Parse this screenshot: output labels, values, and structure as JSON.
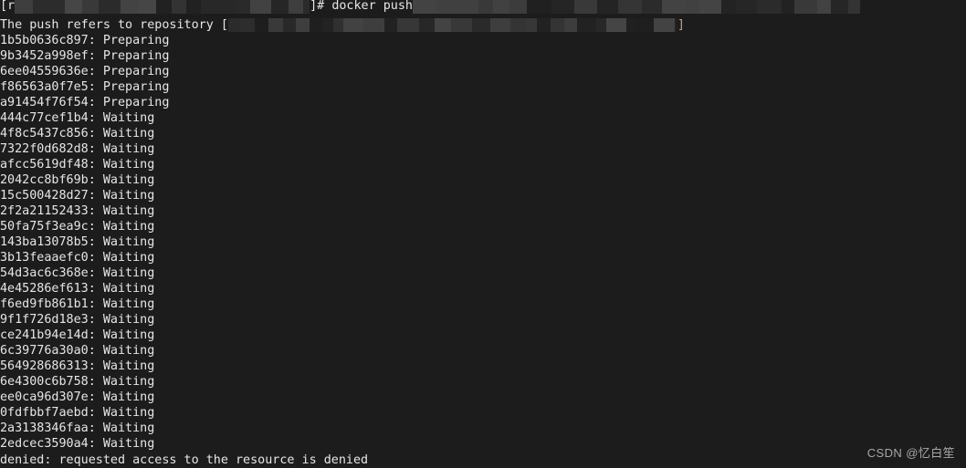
{
  "terminal": {
    "background_color": "#1c1c1c",
    "text_color": "#e6e6e6",
    "highlight_color": "#d7a442",
    "prompt_line": {
      "prefix": "[r",
      "redacted_host_path": "",
      "suffix": "]# ",
      "command": "docker push",
      "redacted_image_ref": ""
    },
    "push_line": {
      "text": "The push refers to repository ",
      "bracket_open": "[",
      "redacted_repo": "",
      "bracket_close": "]"
    },
    "layers": [
      {
        "id": "1b5b0636c897",
        "status": "Preparing"
      },
      {
        "id": "9b3452a998ef",
        "status": "Preparing"
      },
      {
        "id": "6ee04559636e",
        "status": "Preparing"
      },
      {
        "id": "f86563a0f7e5",
        "status": "Preparing"
      },
      {
        "id": "a91454f76f54",
        "status": "Preparing"
      },
      {
        "id": "444c77cef1b4",
        "status": "Waiting"
      },
      {
        "id": "4f8c5437c856",
        "status": "Waiting"
      },
      {
        "id": "7322f0d682d8",
        "status": "Waiting"
      },
      {
        "id": "afcc5619df48",
        "status": "Waiting"
      },
      {
        "id": "2042cc8bf69b",
        "status": "Waiting"
      },
      {
        "id": "15c500428d27",
        "status": "Waiting"
      },
      {
        "id": "2f2a21152433",
        "status": "Waiting"
      },
      {
        "id": "50fa75f3ea9c",
        "status": "Waiting"
      },
      {
        "id": "143ba13078b5",
        "status": "Waiting"
      },
      {
        "id": "3b13feaaefc0",
        "status": "Waiting"
      },
      {
        "id": "54d3ac6c368e",
        "status": "Waiting"
      },
      {
        "id": "4e45286ef613",
        "status": "Waiting"
      },
      {
        "id": "f6ed9fb861b1",
        "status": "Waiting"
      },
      {
        "id": "9f1f726d18e3",
        "status": "Waiting"
      },
      {
        "id": "ce241b94e14d",
        "status": "Waiting"
      },
      {
        "id": "6c39776a30a0",
        "status": "Waiting"
      },
      {
        "id": "564928686313",
        "status": "Waiting"
      },
      {
        "id": "6e4300c6b758",
        "status": "Waiting"
      },
      {
        "id": "ee0ca96d307e",
        "status": "Waiting"
      },
      {
        "id": "0fdfbbf7aebd",
        "status": "Waiting"
      },
      {
        "id": "2a3138346faa",
        "status": "Waiting"
      },
      {
        "id": "2edcec3590a4",
        "status": "Waiting"
      }
    ],
    "error_line": "denied: requested access to the resource is denied"
  },
  "watermark": {
    "text": "CSDN @忆白笙"
  }
}
